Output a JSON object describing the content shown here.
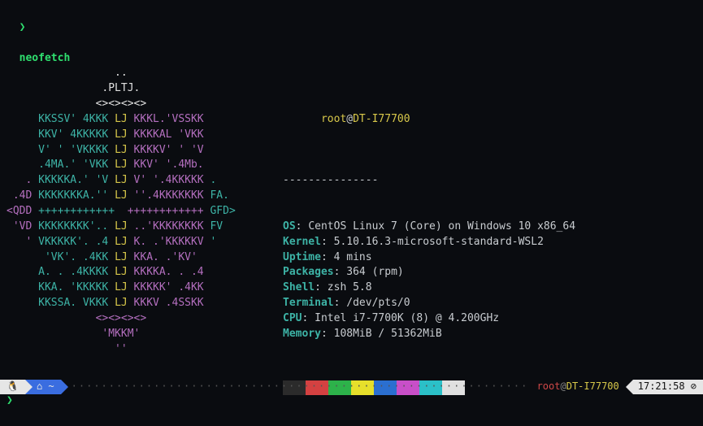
{
  "prompt": {
    "char": "❯",
    "command": "neofetch"
  },
  "logo": [
    [
      [
        "w",
        "                 .."
      ]
    ],
    [
      [
        "w",
        "               .PLTJ."
      ]
    ],
    [
      [
        "w",
        "              <><><><>"
      ]
    ],
    [
      [
        "c",
        "     KKSSV' 4KKK "
      ],
      [
        "y",
        "LJ"
      ],
      [
        "p",
        " KKKL.'VSSKK"
      ]
    ],
    [
      [
        "c",
        "     KKV' 4KKKKK "
      ],
      [
        "y",
        "LJ"
      ],
      [
        "p",
        " KKKKAL 'VKK"
      ]
    ],
    [
      [
        "c",
        "     V' ' 'VKKKK "
      ],
      [
        "y",
        "LJ"
      ],
      [
        "p",
        " KKKKV' ' 'V"
      ]
    ],
    [
      [
        "c",
        "     .4MA.' 'VKK "
      ],
      [
        "y",
        "LJ"
      ],
      [
        "p",
        " KKV' '.4Mb."
      ]
    ],
    [
      [
        "p",
        "   . "
      ],
      [
        "c",
        "KKKKKA.' 'V "
      ],
      [
        "y",
        "LJ"
      ],
      [
        "p",
        " V' '.4KKKKK "
      ],
      [
        "c",
        "."
      ]
    ],
    [
      [
        "p",
        " .4D "
      ],
      [
        "c",
        "KKKKKKKA.'' "
      ],
      [
        "y",
        "LJ"
      ],
      [
        "p",
        " ''.4KKKKKKK "
      ],
      [
        "c",
        "FA."
      ]
    ],
    [
      [
        "p",
        "<QDD "
      ],
      [
        "c",
        "++++++++++++  "
      ],
      [
        "p",
        "++++++++++++ "
      ],
      [
        "c",
        "GFD>"
      ]
    ],
    [
      [
        "p",
        " 'VD "
      ],
      [
        "c",
        "KKKKKKKK'.. "
      ],
      [
        "y",
        "LJ"
      ],
      [
        "p",
        " ..'KKKKKKKK "
      ],
      [
        "c",
        "FV"
      ]
    ],
    [
      [
        "p",
        "   ' "
      ],
      [
        "c",
        "VKKKKK'. .4 "
      ],
      [
        "y",
        "LJ"
      ],
      [
        "p",
        " K. .'KKKKKV "
      ],
      [
        "c",
        "'"
      ]
    ],
    [
      [
        "c",
        "      'VK'. .4KK "
      ],
      [
        "y",
        "LJ"
      ],
      [
        "p",
        " KKA. .'KV'"
      ]
    ],
    [
      [
        "c",
        "     A. . .4KKKK "
      ],
      [
        "y",
        "LJ"
      ],
      [
        "p",
        " KKKKA. . .4"
      ]
    ],
    [
      [
        "c",
        "     KKA. 'KKKKK "
      ],
      [
        "y",
        "LJ"
      ],
      [
        "p",
        " KKKKK' .4KK"
      ]
    ],
    [
      [
        "c",
        "     KKSSA. VKKK "
      ],
      [
        "y",
        "LJ"
      ],
      [
        "p",
        " KKKV .4SSKK"
      ]
    ],
    [
      [
        "p",
        "              <><><><>"
      ]
    ],
    [
      [
        "p",
        "               'MKKM'"
      ]
    ],
    [
      [
        "p",
        "                 ''"
      ]
    ]
  ],
  "header": {
    "user": "root",
    "at": "@",
    "host": "DT-I77700",
    "sep": "---------------"
  },
  "info": [
    {
      "key": "OS",
      "val": "CentOS Linux 7 (Core) on Windows 10 x86_64"
    },
    {
      "key": "Kernel",
      "val": "5.10.16.3-microsoft-standard-WSL2"
    },
    {
      "key": "Uptime",
      "val": "4 mins"
    },
    {
      "key": "Packages",
      "val": "364 (rpm)"
    },
    {
      "key": "Shell",
      "val": "zsh 5.8"
    },
    {
      "key": "Terminal",
      "val": "/dev/pts/0"
    },
    {
      "key": "CPU",
      "val": "Intel i7-7700K (8) @ 4.200GHz"
    },
    {
      "key": "Memory",
      "val": "108MiB / 51362MiB"
    }
  ],
  "footer": {
    "penguin": "🐧",
    "home": "⌂ ~",
    "user": "root",
    "at": "@",
    "host": "DT-I77700",
    "clock": "17:21:58 ⊘"
  }
}
